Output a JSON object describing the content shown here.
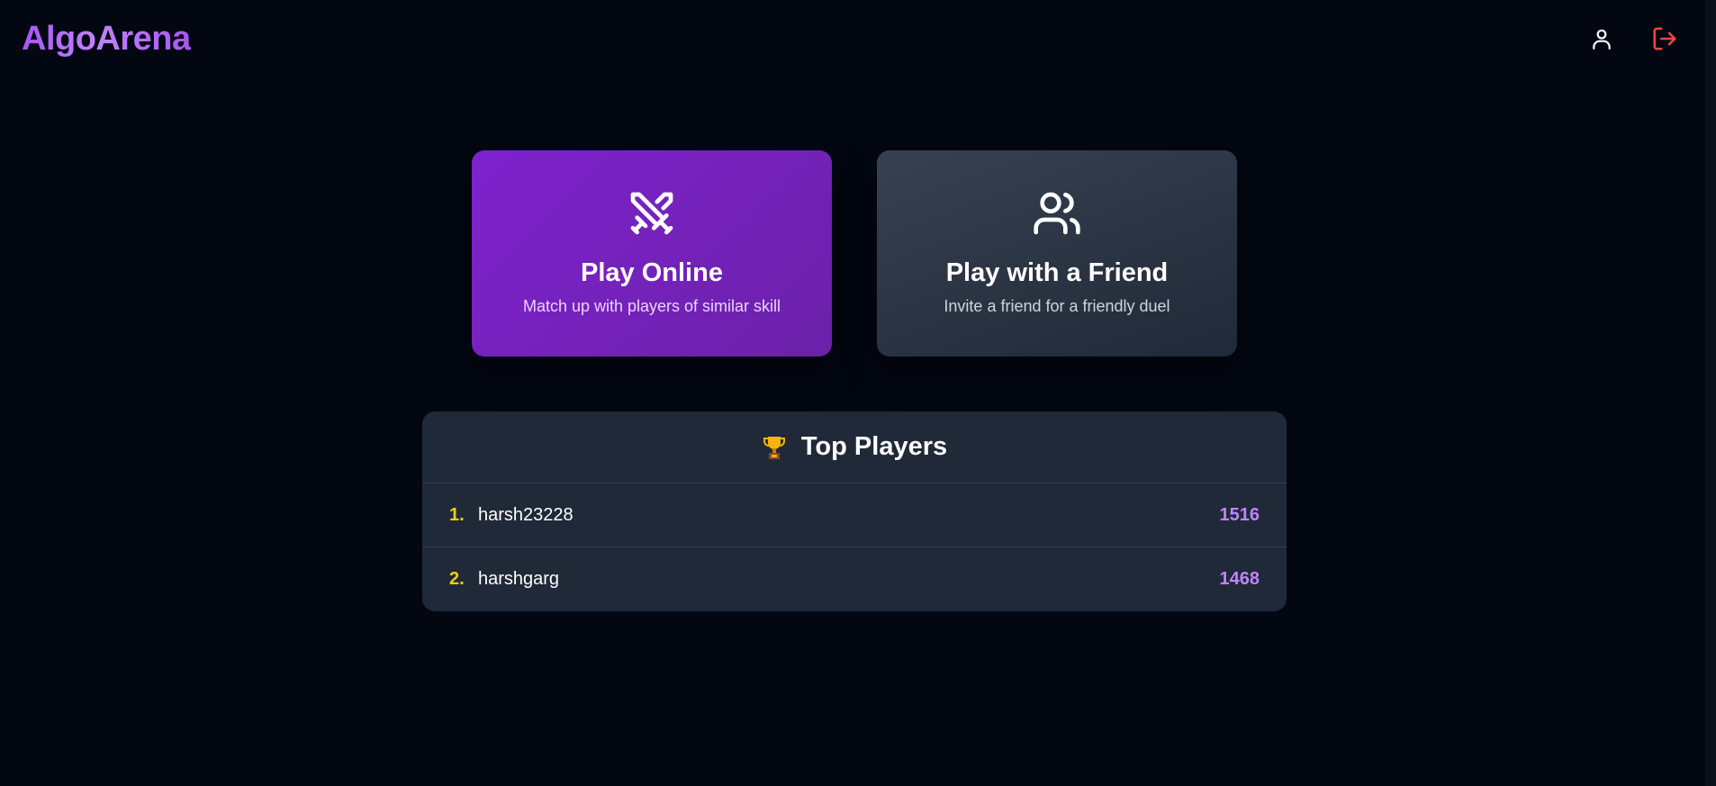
{
  "header": {
    "brand": "AlgoArena",
    "profile_icon": "user-icon",
    "logout_icon": "logout-icon"
  },
  "modes": [
    {
      "icon": "crossed-swords-icon",
      "title": "Play Online",
      "subtitle": "Match up with players of similar skill"
    },
    {
      "icon": "users-icon",
      "title": "Play with a Friend",
      "subtitle": "Invite a friend for a friendly duel"
    }
  ],
  "leaderboard": {
    "icon": "trophy-icon",
    "title": "Top Players",
    "players": [
      {
        "rank": "1.",
        "name": "harsh23228",
        "rating": "1516"
      },
      {
        "rank": "2.",
        "name": "harshgarg",
        "rating": "1468"
      }
    ]
  },
  "colors": {
    "background": "#030712",
    "brand": "#a855f7",
    "online_card": "#7e22ce",
    "friend_card": "#374151",
    "panel": "#1f2937",
    "rank": "#facc15",
    "rating": "#c084fc",
    "logout": "#ef4444"
  }
}
